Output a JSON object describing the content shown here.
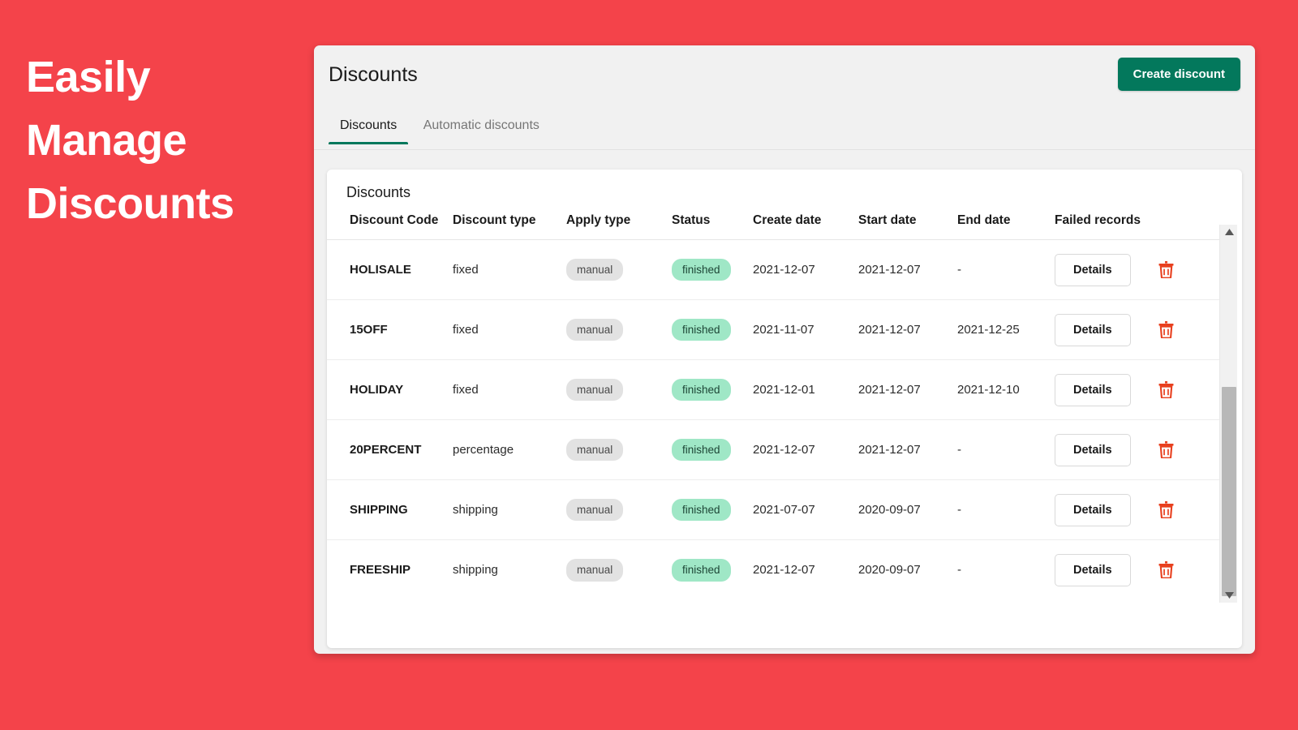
{
  "promo": {
    "lines": [
      "Easily",
      "Manage",
      "Discounts"
    ]
  },
  "colors": {
    "background_red": "#F4434A",
    "brand_green": "#03785C",
    "badge_manual_bg": "#E2E2E2",
    "badge_finished_bg": "#9FE7C6",
    "trash_red": "#E8401F",
    "panel_gray": "#F1F1F1"
  },
  "header": {
    "title": "Discounts",
    "create_button": "Create discount"
  },
  "tabs": [
    {
      "label": "Discounts",
      "active": true
    },
    {
      "label": "Automatic discounts",
      "active": false
    }
  ],
  "card": {
    "title": "Discounts",
    "columns": [
      "Discount Code",
      "Discount type",
      "Apply type",
      "Status",
      "Create date",
      "Start date",
      "End date",
      "Failed records"
    ],
    "rows": [
      {
        "code": "HOLISALE",
        "discount_type": "fixed",
        "apply_type": "manual",
        "status": "finished",
        "create_date": "2021-12-07",
        "start_date": "2021-12-07",
        "end_date": "-",
        "details_label": "Details"
      },
      {
        "code": "15OFF",
        "discount_type": "fixed",
        "apply_type": "manual",
        "status": "finished",
        "create_date": "2021-11-07",
        "start_date": "2021-12-07",
        "end_date": "2021-12-25",
        "details_label": "Details"
      },
      {
        "code": "HOLIDAY",
        "discount_type": "fixed",
        "apply_type": "manual",
        "status": "finished",
        "create_date": "2021-12-01",
        "start_date": "2021-12-07",
        "end_date": "2021-12-10",
        "details_label": "Details"
      },
      {
        "code": "20PERCENT",
        "discount_type": "percentage",
        "apply_type": "manual",
        "status": "finished",
        "create_date": "2021-12-07",
        "start_date": "2021-12-07",
        "end_date": "-",
        "details_label": "Details"
      },
      {
        "code": "SHIPPING",
        "discount_type": "shipping",
        "apply_type": "manual",
        "status": "finished",
        "create_date": "2021-07-07",
        "start_date": "2020-09-07",
        "end_date": "-",
        "details_label": "Details"
      },
      {
        "code": "FREESHIP",
        "discount_type": "shipping",
        "apply_type": "manual",
        "status": "finished",
        "create_date": "2021-12-07",
        "start_date": "2020-09-07",
        "end_date": "-",
        "details_label": "Details"
      }
    ]
  },
  "icons": {
    "delete": "trash-icon",
    "scroll_up": "caret-up-icon",
    "scroll_down": "caret-down-icon"
  }
}
